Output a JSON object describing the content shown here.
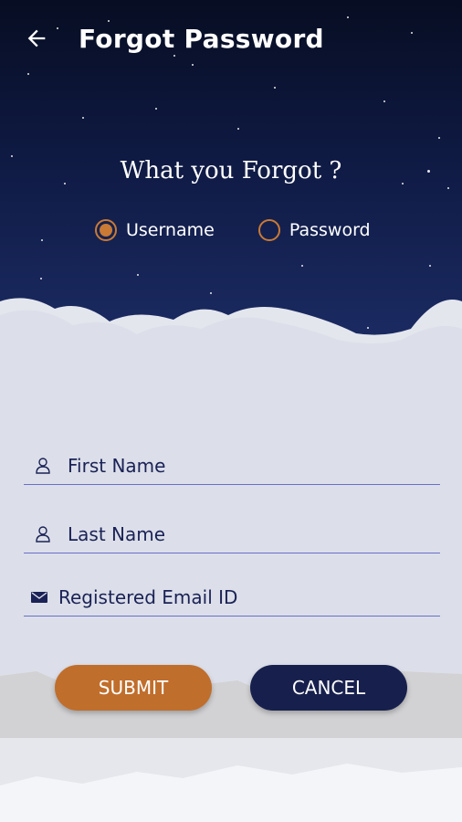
{
  "header": {
    "back_icon": "arrow-left-icon",
    "title": "Forgot  Password"
  },
  "question": "What you Forgot ?",
  "radios": [
    {
      "label": "Username",
      "selected": true
    },
    {
      "label": "Password",
      "selected": false
    }
  ],
  "form": {
    "first_name": {
      "placeholder": "First Name",
      "icon": "person-icon"
    },
    "last_name": {
      "placeholder": "Last Name",
      "icon": "person-icon"
    },
    "email": {
      "placeholder": "Registered Email ID",
      "icon": "mail-icon"
    }
  },
  "buttons": {
    "submit": "SUBMIT",
    "cancel": "CANCEL"
  },
  "colors": {
    "accent": "#c06e2c",
    "navy": "#17204d",
    "sky_top": "#070d22",
    "cloud": "#dfe2ec"
  }
}
